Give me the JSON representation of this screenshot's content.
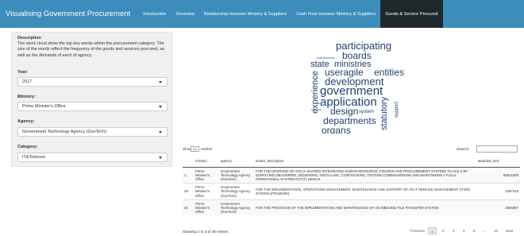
{
  "navbar": {
    "brand": "Visualising Government Procurement",
    "tabs": [
      {
        "label": "Introduction"
      },
      {
        "label": "Overview"
      },
      {
        "label": "Relationship between Ministry & Suppliers"
      },
      {
        "label": "Cash Flow between Ministry & Suppliers"
      },
      {
        "label": "Goods & Service Procured"
      }
    ]
  },
  "sidebar": {
    "description_title": "Description",
    "description_text": "The word cloud show the top key words within the procurement category. The size of the words reflect the frequency of the goods and services procured, as well as the demands of each of agency.",
    "year_label": "Year:",
    "year_value": "2017",
    "ministry_label": "Ministry:",
    "ministry_value": "Prime Minister's Office",
    "agency_label": "Agency:",
    "agency_value": "Government Technology Agency (GovTech)",
    "category_label": "Category:",
    "category_value": "IT&Telecom"
  },
  "wordcloud": {
    "colors": {
      "word": "#1f3f73",
      "small": "#3a55a0"
    },
    "words": [
      {
        "text": "participating"
      },
      {
        "text": "boards"
      },
      {
        "text": "maintenance"
      },
      {
        "text": "state"
      },
      {
        "text": "ministries"
      },
      {
        "text": "useragile"
      },
      {
        "text": "entities"
      },
      {
        "text": "development"
      },
      {
        "text": "experience"
      },
      {
        "text": "government"
      },
      {
        "text": "application"
      },
      {
        "text": "software"
      },
      {
        "text": "design"
      },
      {
        "text": "system"
      },
      {
        "text": "departments"
      },
      {
        "text": "organs"
      },
      {
        "text": "statutory"
      },
      {
        "text": "support"
      }
    ]
  },
  "table": {
    "show_label": "Show",
    "length_value": "10",
    "entries_label": "entries",
    "search_label": "Search:",
    "columns": [
      "",
      "ministry",
      "agency",
      "tender_description",
      "awarded_amt"
    ],
    "rows": [
      {
        "idx": "1",
        "ministry": "Prime Minister's Office",
        "agency": "Government Technology Agency (GovTech)",
        "desc": "FOR THE UPGRADE OF ACE (A SHARED INTEGRATED HUMAN RESOURCE, FINANCE AND PROCUREMENT SYSTEM) TO ACE II BY SUPPLYING,DELIVERING, DESIGNING, INSTALLING, CONFIGURING, TESTING,COMMISSIONING AND MAINTAINING A FULLY OPERATIONAL SYSTEM GVT(T) 16002-5",
        "amt": "60521600"
      },
      {
        "idx": "29",
        "ministry": "Prime Minister's Office",
        "agency": "Government Technology Agency (GovTech)",
        "desc": "FOR THE IMPLEMENTATION, OPERATIONS MANAGEMENT, MAINTENANCE AND SUPPORT OF AN IT SERVICE MANAGEMENT (ITSM) SYSTEM (PR165200)",
        "amt": "4397315"
      },
      {
        "idx": "30",
        "ministry": "Prime Minister's Office",
        "agency": "Government Technology Agency (GovTech)",
        "desc": "FOR THE PROVISION OF THE IMPLEMENTATION AND MAINTENANCE OF AN INBOUND FILE TRANSFER SYSTEM",
        "amt": "2906897"
      }
    ],
    "info": "Showing 1 to 3 of 36 entries",
    "pagination": {
      "previous": "Previous",
      "pages": [
        "1",
        "2",
        "3",
        "4",
        "5",
        "…",
        "12"
      ],
      "next": "Next"
    }
  }
}
